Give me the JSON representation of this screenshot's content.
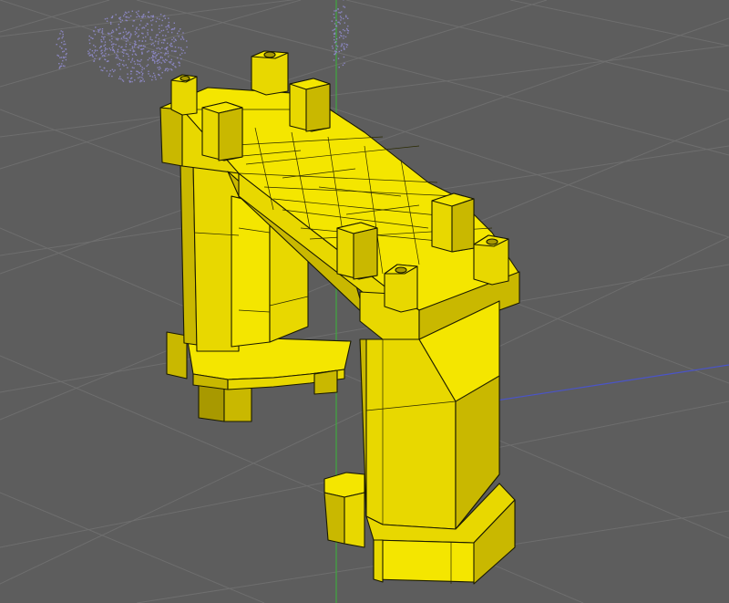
{
  "viewport": {
    "background_color": "#5d5d5d",
    "grid_color": "#6e6e6e",
    "axis_y_color": "#3fa83f",
    "axis_x_color": "#4a54c8"
  },
  "model": {
    "fill_color": "#e8d800",
    "light_fill": "#f4e600",
    "shade_fill": "#c9b800",
    "dark_fill": "#a89900",
    "wire_color": "#1a1a00"
  },
  "point_cloud": {
    "color": "#8a86c0",
    "icon": "point-cloud-scan"
  }
}
